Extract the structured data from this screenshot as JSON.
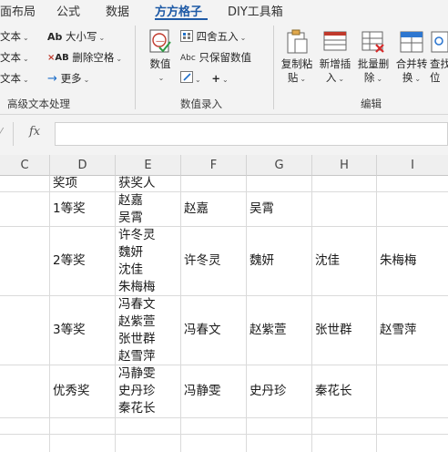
{
  "tabs": [
    {
      "label": "面布局",
      "active": false
    },
    {
      "label": "公式",
      "active": false
    },
    {
      "label": "数据",
      "active": false
    },
    {
      "label": "方方格子",
      "active": true
    },
    {
      "label": "DIY工具箱",
      "active": false
    }
  ],
  "ribbon": {
    "text_group": {
      "items": [
        "文本",
        "文本",
        "文本"
      ],
      "case_label": "大小写",
      "delete_space_label": "删除空格",
      "more_label": "更多",
      "group_label": "高级文本处理"
    },
    "numeric_group": {
      "value_label": "数值",
      "round_label": "四舍五入",
      "keep_value_label": "只保留数值",
      "group_label": "数值录入"
    },
    "edit_group": {
      "buttons": [
        {
          "line1": "复制粘",
          "line2": "贴"
        },
        {
          "line1": "新增插",
          "line2": "入"
        },
        {
          "line1": "批量删",
          "line2": "除"
        },
        {
          "line1": "合并转",
          "line2": "换"
        },
        {
          "line1": "查找",
          "line2": "位"
        }
      ],
      "group_label": "编辑"
    }
  },
  "formula_bar": {
    "fx_label": "fx",
    "value": ""
  },
  "sheet": {
    "columns": [
      "C",
      "D",
      "E",
      "F",
      "G",
      "H",
      "I"
    ],
    "rows": [
      {
        "D": "奖项",
        "E": [
          "获奖人"
        ],
        "F": "",
        "G": "",
        "H": "",
        "I": ""
      },
      {
        "D": "1等奖",
        "E": [
          "赵嘉",
          "吴霄"
        ],
        "F": "赵嘉",
        "G": "吴霄",
        "H": "",
        "I": ""
      },
      {
        "D": "2等奖",
        "E": [
          "许冬灵",
          "魏妍",
          "沈佳",
          "朱梅梅"
        ],
        "F": "许冬灵",
        "G": "魏妍",
        "H": "沈佳",
        "I": "朱梅梅"
      },
      {
        "D": "3等奖",
        "E": [
          "冯春文",
          "赵紫萱",
          "张世群",
          "赵雪萍"
        ],
        "F": "冯春文",
        "G": "赵紫萱",
        "H": "张世群",
        "I": "赵雪萍"
      },
      {
        "D": "优秀奖",
        "E": [
          "冯静雯",
          "史丹珍",
          "秦花长"
        ],
        "F": "冯静雯",
        "G": "史丹珍",
        "H": "秦花长",
        "I": ""
      }
    ]
  },
  "colors": {
    "accent": "#1e5aa6",
    "ribbon_bg": "#f3f3f3",
    "grid": "#dadada"
  }
}
